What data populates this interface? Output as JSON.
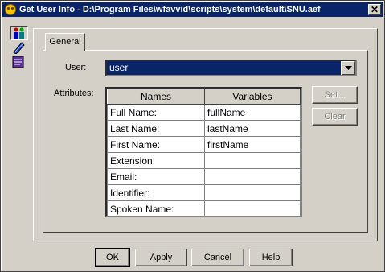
{
  "window": {
    "title": "Get User Info - D:\\Program Files\\wfavvid\\scripts\\system\\default\\SNU.aef",
    "close_label": "✕"
  },
  "tabs": [
    {
      "label": "General"
    }
  ],
  "form": {
    "user_label": "User:",
    "user_value": "user",
    "attributes_label": "Attributes:"
  },
  "grid": {
    "columns": [
      "Names",
      "Variables"
    ],
    "rows": [
      {
        "name": "Full Name:",
        "variable": "fullName"
      },
      {
        "name": "Last Name:",
        "variable": "lastName"
      },
      {
        "name": "First Name:",
        "variable": "firstName"
      },
      {
        "name": "Extension:",
        "variable": ""
      },
      {
        "name": "Email:",
        "variable": ""
      },
      {
        "name": "Identifier:",
        "variable": ""
      },
      {
        "name": "Spoken Name:",
        "variable": ""
      }
    ]
  },
  "side_buttons": {
    "set": "Set...",
    "clear": "Clear"
  },
  "footer": {
    "ok": "OK",
    "apply": "Apply",
    "cancel": "Cancel",
    "help": "Help"
  },
  "icons": {
    "app": "app-icon",
    "tool1": "users-icon",
    "tool2": "tag-icon",
    "tool3": "document-icon"
  }
}
